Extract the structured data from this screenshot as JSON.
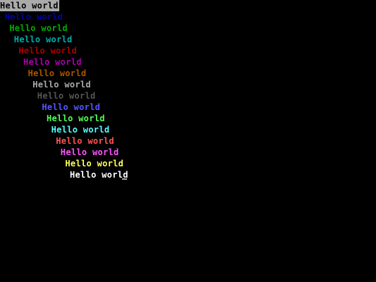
{
  "screen": {
    "background": "#000000",
    "cursor_color": "#aaaaaa",
    "lines": [
      {
        "text": "Hello world",
        "color": "#000000",
        "background": "#aaaaaa"
      },
      {
        "text": "Hello world",
        "color": "#0000aa"
      },
      {
        "text": "Hello world",
        "color": "#00aa00"
      },
      {
        "text": "Hello world",
        "color": "#00aaaa"
      },
      {
        "text": "Hello world",
        "color": "#aa0000"
      },
      {
        "text": "Hello world",
        "color": "#aa00aa"
      },
      {
        "text": "Hello world",
        "color": "#aa5500"
      },
      {
        "text": "Hello world",
        "color": "#aaaaaa"
      },
      {
        "text": "Hello world",
        "color": "#555555"
      },
      {
        "text": "Hello world",
        "color": "#5555ff"
      },
      {
        "text": "Hello world",
        "color": "#55ff55"
      },
      {
        "text": "Hello world",
        "color": "#55ffff"
      },
      {
        "text": "Hello world",
        "color": "#ff5555"
      },
      {
        "text": "Hello world",
        "color": "#ff55ff"
      },
      {
        "text": "Hello world",
        "color": "#ffff55"
      },
      {
        "text": "Hello world",
        "color": "#ffffff"
      }
    ]
  }
}
